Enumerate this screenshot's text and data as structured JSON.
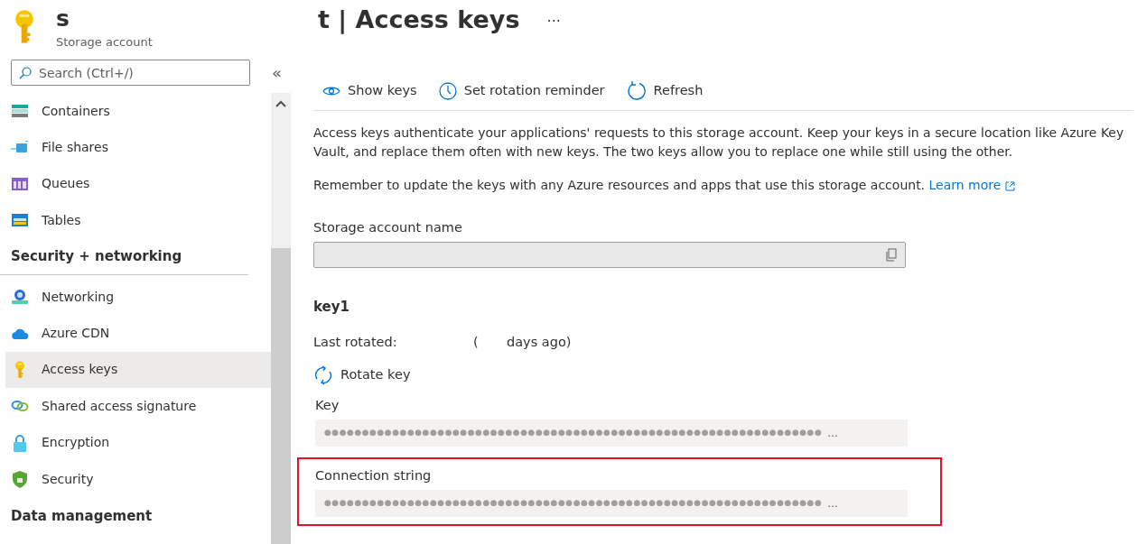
{
  "resource": {
    "name": "s",
    "type": "Storage account"
  },
  "page_title": "t | Access keys",
  "more": "···",
  "search": {
    "placeholder": "Search (Ctrl+/)"
  },
  "collapse": "«",
  "sidebar": {
    "items": [
      {
        "kind": "item",
        "label": "Containers",
        "selected": false
      },
      {
        "kind": "item",
        "label": "File shares",
        "selected": false
      },
      {
        "kind": "item",
        "label": "Queues",
        "selected": false
      },
      {
        "kind": "item",
        "label": "Tables",
        "selected": false
      },
      {
        "kind": "header",
        "label": "Security + networking"
      },
      {
        "kind": "item",
        "label": "Networking",
        "selected": false
      },
      {
        "kind": "item",
        "label": "Azure CDN",
        "selected": false
      },
      {
        "kind": "item",
        "label": "Access keys",
        "selected": true
      },
      {
        "kind": "item",
        "label": "Shared access signature",
        "selected": false
      },
      {
        "kind": "item",
        "label": "Encryption",
        "selected": false
      },
      {
        "kind": "item",
        "label": "Security",
        "selected": false
      },
      {
        "kind": "header",
        "label": "Data management"
      }
    ]
  },
  "toolbar": [
    {
      "label": "Show keys"
    },
    {
      "label": "Set rotation reminder"
    },
    {
      "label": "Refresh"
    }
  ],
  "description": "Access keys authenticate your applications' requests to this storage account. Keep your keys in a secure location like Azure Key Vault, and replace them often with new keys. The two keys allow you to replace one while still using the other.",
  "reminder": {
    "text": "Remember to update the keys with any Azure resources and apps that use this storage account.",
    "link": "Learn more"
  },
  "storage_name": {
    "label": "Storage account name"
  },
  "key1": {
    "title": "key1",
    "last_rotated_label": "Last rotated:",
    "paren": "(",
    "days_ago": "days ago)",
    "rotate": "Rotate key",
    "fields": [
      {
        "label": "Key",
        "value": "●●●●●●●●●●●●●●●●●●●●●●●●●●●●●●●●●●●●●●●●●●●●●●●●●●●●●●●●●●●●●●●●●●",
        "ellipsis": "...",
        "highlighted": false
      },
      {
        "label": "Connection string",
        "value": "●●●●●●●●●●●●●●●●●●●●●●●●●●●●●●●●●●●●●●●●●●●●●●●●●●●●●●●●●●●●●●●●●●",
        "ellipsis": "...",
        "highlighted": true
      }
    ]
  }
}
